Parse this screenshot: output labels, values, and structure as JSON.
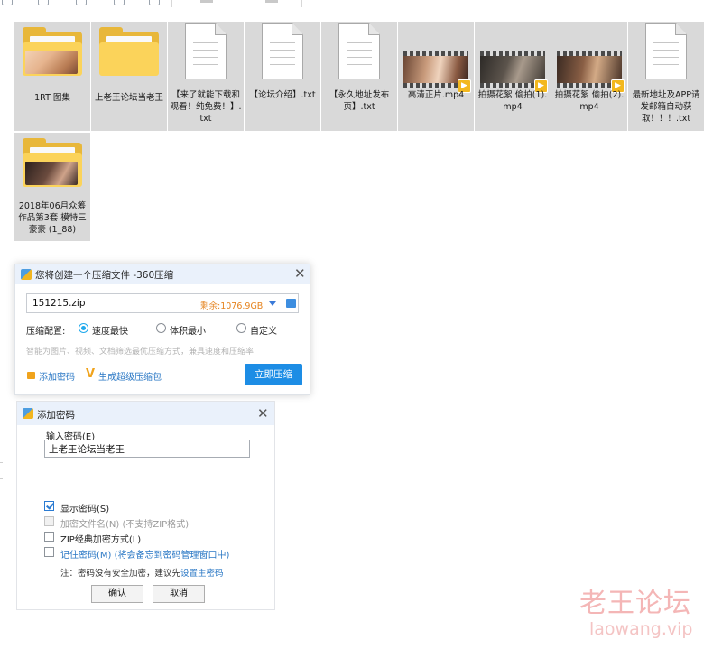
{
  "files": [
    {
      "name": "1RT 图集",
      "kind": "folder",
      "photo": "warm"
    },
    {
      "name": "上老王论坛当老王",
      "kind": "folder-docs"
    },
    {
      "name": "【来了就能下载和观看！纯免费！】.txt",
      "kind": "txt"
    },
    {
      "name": "【论坛介绍】.txt",
      "kind": "txt"
    },
    {
      "name": "【永久地址发布页】.txt",
      "kind": "txt"
    },
    {
      "name": "高清正片.mp4",
      "kind": "video"
    },
    {
      "name": "拍摄花絮 偷拍(1).mp4",
      "kind": "video"
    },
    {
      "name": "拍摄花絮 偷拍(2).mp4",
      "kind": "video"
    },
    {
      "name": "最新地址及APP请发邮箱自动获取！！！.txt",
      "kind": "txt"
    },
    {
      "name": "2018年06月众筹作品第3套 模特三 豪豪 (1_88)",
      "kind": "folder",
      "photo": "dark"
    }
  ],
  "compress_dialog": {
    "title": "您将创建一个压缩文件 -360压缩",
    "filename": "151215.zip",
    "free_space": "剩余:1076.9GB",
    "config_label": "压缩配置:",
    "options": [
      {
        "label": "速度最快",
        "selected": true
      },
      {
        "label": "体积最小",
        "selected": false
      },
      {
        "label": "自定义",
        "selected": false
      }
    ],
    "hint": "智能为图片、视频、文档筛选最优压缩方式，兼具速度和压缩率",
    "add_password": "添加密码",
    "super_package": "生成超级压缩包",
    "compress_now": "立即压缩"
  },
  "password_dialog": {
    "title": "添加密码",
    "input_label": "输入密码(E)",
    "password_value": "上老王论坛当老王",
    "checkboxes": [
      {
        "label": "显示密码(S)",
        "checked": true,
        "disabled": false
      },
      {
        "label": "加密文件名(N) (不支持ZIP格式)",
        "checked": false,
        "disabled": true
      },
      {
        "label": "ZIP经典加密方式(L)",
        "checked": false,
        "disabled": false
      },
      {
        "label": "记住密码(M) (将会备忘到密码管理窗口中)",
        "checked": false,
        "disabled": false
      }
    ],
    "note_prefix": "注：密码没有安全加密，建议先",
    "note_link": "设置主密码",
    "ok": "确认",
    "cancel": "取消"
  },
  "watermark": {
    "title": "老王论坛",
    "url": "laowang.vip"
  },
  "colors": {
    "accent": "#1d8de5",
    "tile_bg": "#d9d9d9",
    "folder": "#fbd35a",
    "watermark": "#f4b6b6"
  }
}
